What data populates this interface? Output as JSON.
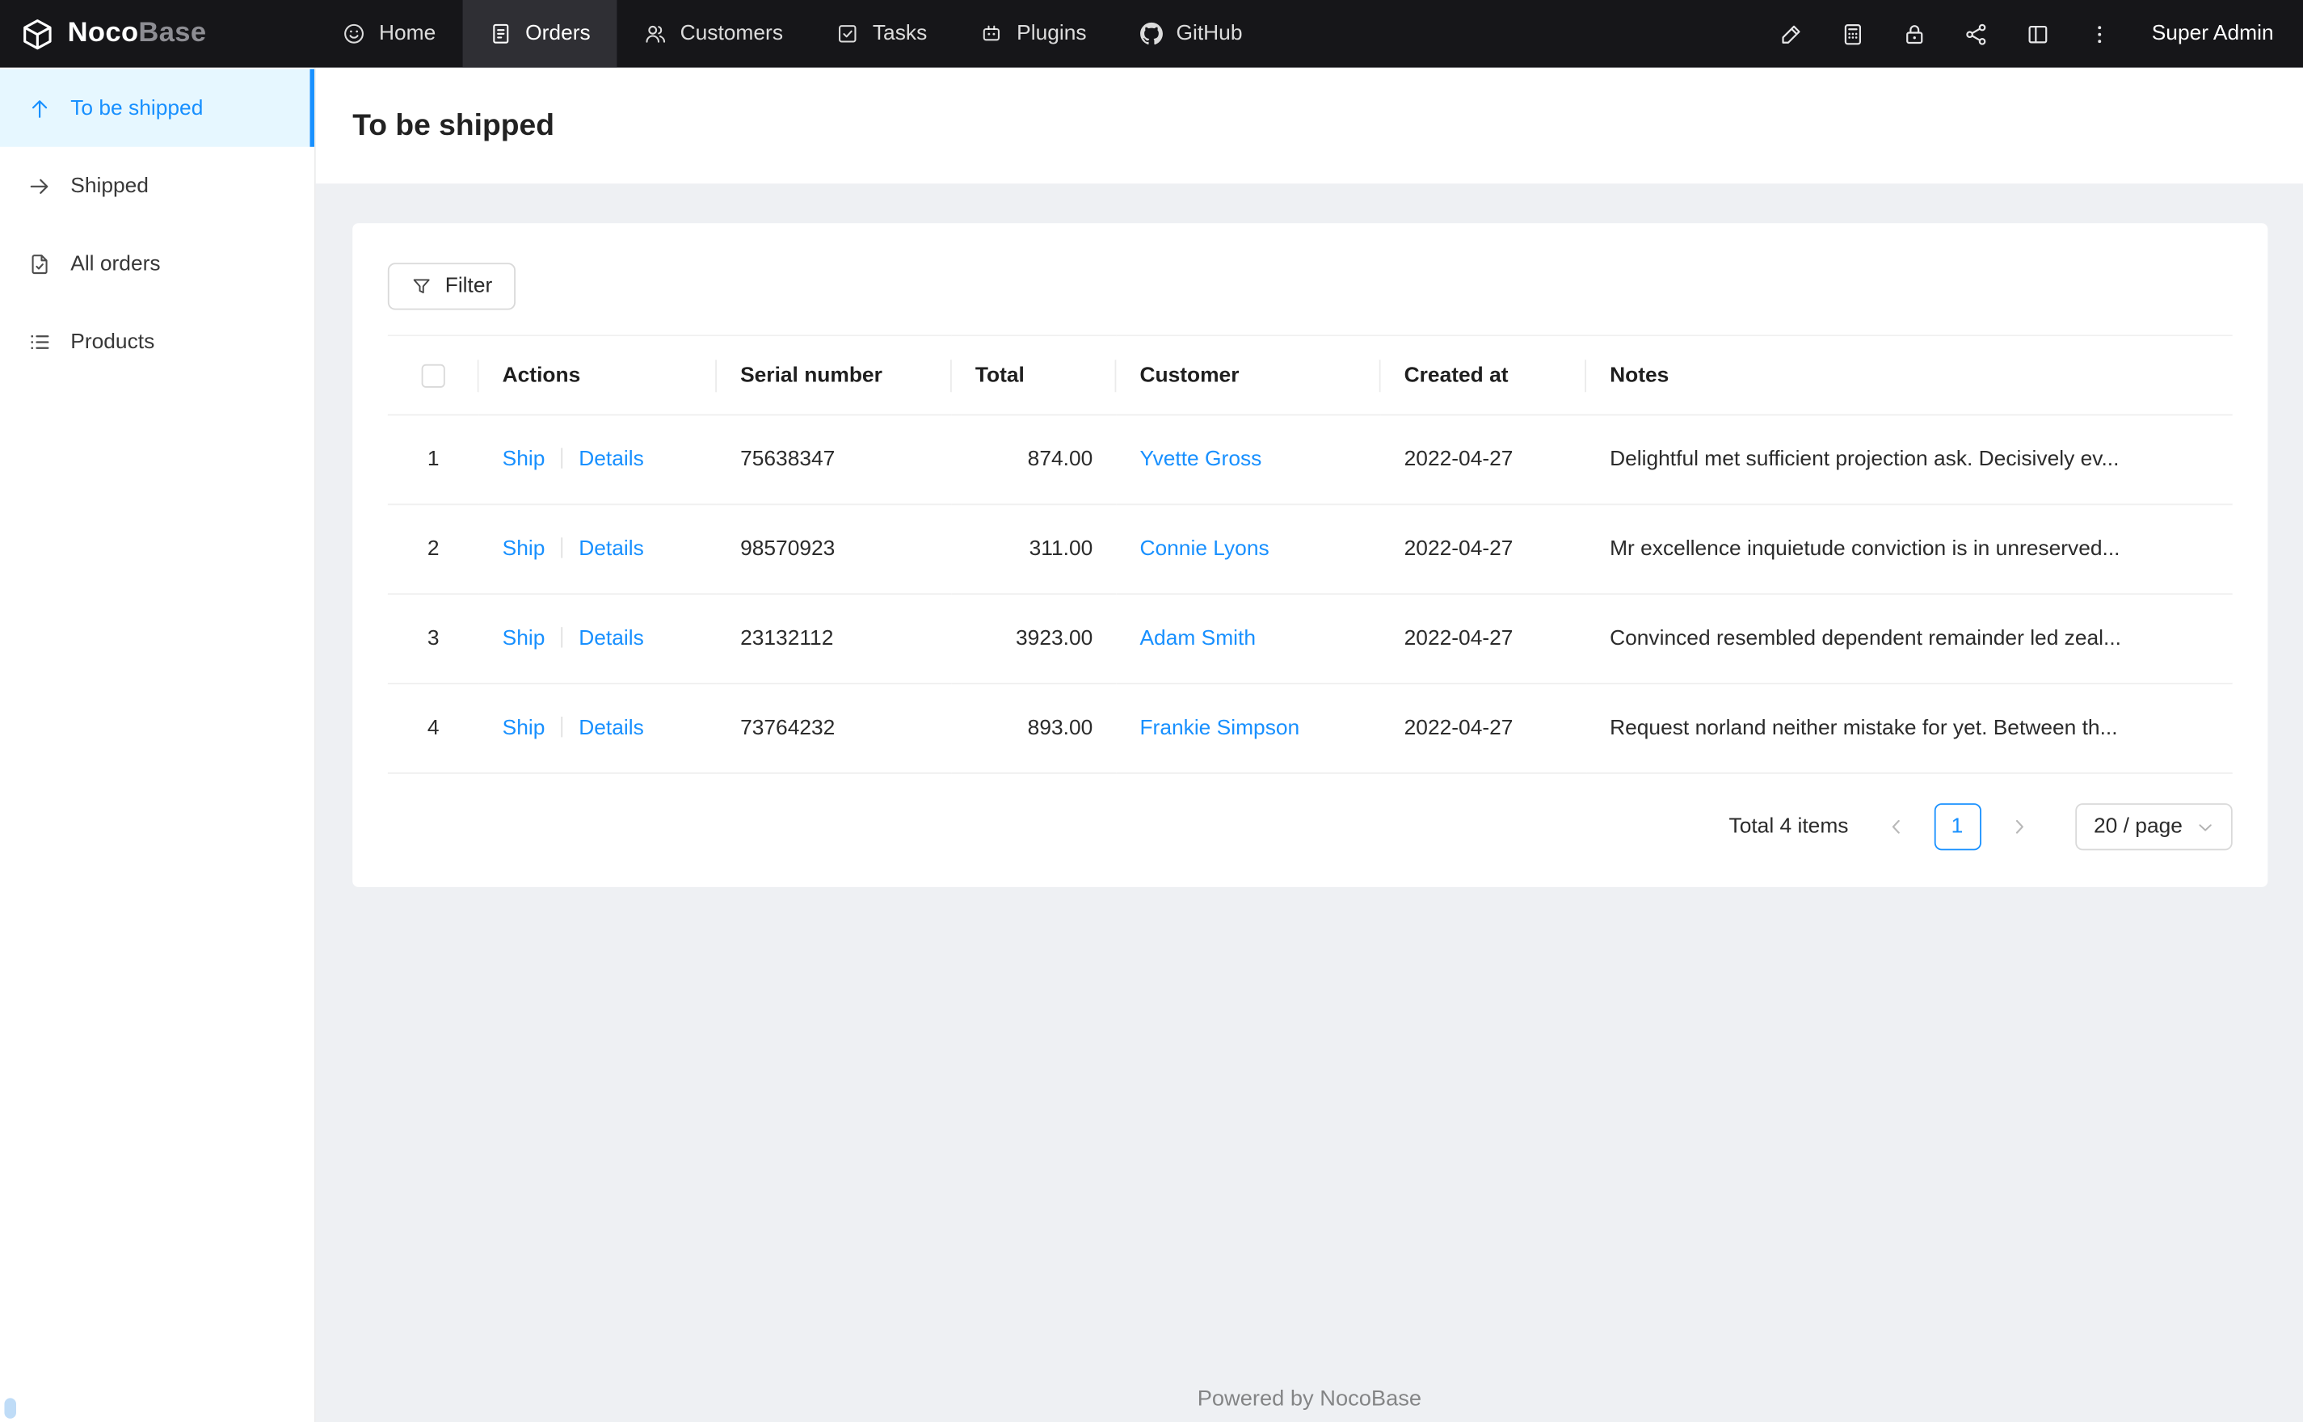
{
  "colors": {
    "accent": "#1890ff",
    "navbar_bg": "#161619",
    "navbar_active_bg": "#2f2f34",
    "sidebar_active_bg": "#e6f7ff",
    "page_bg": "#eef0f3",
    "link": "#1890ff"
  },
  "brand": {
    "name_bold": "Noco",
    "name_light": "Base"
  },
  "navbar": {
    "items": [
      {
        "label": "Home",
        "icon": "smiley-face-icon"
      },
      {
        "label": "Orders",
        "icon": "receipt-file-icon",
        "active": true
      },
      {
        "label": "Customers",
        "icon": "user-group-icon"
      },
      {
        "label": "Tasks",
        "icon": "check-square-icon"
      },
      {
        "label": "Plugins",
        "icon": "robot-icon"
      },
      {
        "label": "GitHub",
        "icon": "github-icon"
      }
    ],
    "right_icons": [
      "highlighter-icon",
      "calculator-icon",
      "lock-icon",
      "share-nodes-icon",
      "layout-icon",
      "more-vertical-icon"
    ],
    "user": "Super Admin"
  },
  "sidebar": {
    "items": [
      {
        "label": "To be shipped",
        "icon": "arrow-up-icon",
        "active": true
      },
      {
        "label": "Shipped",
        "icon": "arrow-right-icon",
        "active": false
      },
      {
        "label": "All orders",
        "icon": "file-check-icon",
        "active": false
      },
      {
        "label": "Products",
        "icon": "list-icon",
        "active": false
      }
    ]
  },
  "page": {
    "title": "To be shipped"
  },
  "toolbar": {
    "filter_label": "Filter"
  },
  "table": {
    "columns": [
      "Actions",
      "Serial number",
      "Total",
      "Customer",
      "Created at",
      "Notes"
    ],
    "action_labels": {
      "ship": "Ship",
      "details": "Details"
    },
    "rows": [
      {
        "index": "1",
        "serial": "75638347",
        "total": "874.00",
        "customer": "Yvette Gross",
        "created_at": "2022-04-27",
        "notes": "Delightful met sufficient projection ask. Decisively ev..."
      },
      {
        "index": "2",
        "serial": "98570923",
        "total": "311.00",
        "customer": "Connie Lyons",
        "created_at": "2022-04-27",
        "notes": "Mr excellence inquietude conviction is in unreserved..."
      },
      {
        "index": "3",
        "serial": "23132112",
        "total": "3923.00",
        "customer": "Adam Smith",
        "created_at": "2022-04-27",
        "notes": "Convinced resembled dependent remainder led zeal..."
      },
      {
        "index": "4",
        "serial": "73764232",
        "total": "893.00",
        "customer": "Frankie Simpson",
        "created_at": "2022-04-27",
        "notes": "Request norland neither mistake for yet. Between th..."
      }
    ]
  },
  "pagination": {
    "total_text": "Total 4 items",
    "page": "1",
    "page_size": "20 / page"
  },
  "footer": {
    "text": "Powered by NocoBase"
  }
}
